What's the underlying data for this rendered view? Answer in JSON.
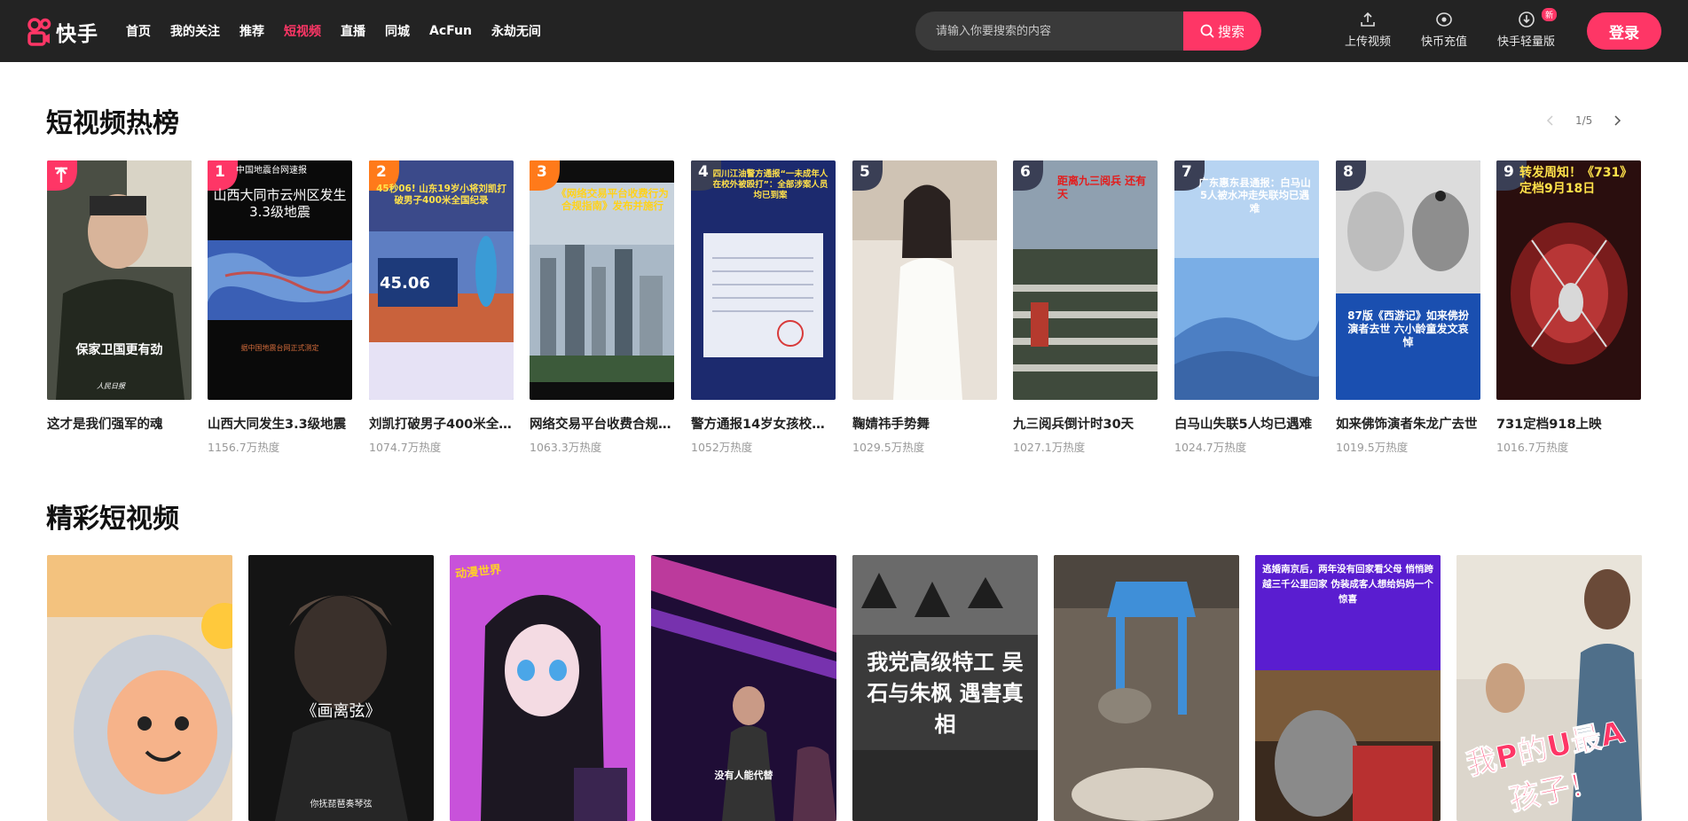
{
  "header": {
    "logo_text": "快手",
    "nav": [
      {
        "label": "首页",
        "active": false
      },
      {
        "label": "我的关注",
        "active": false
      },
      {
        "label": "推荐",
        "active": false
      },
      {
        "label": "短视频",
        "active": true
      },
      {
        "label": "直播",
        "active": false
      },
      {
        "label": "同城",
        "active": false
      },
      {
        "label": "AcFun",
        "active": false
      },
      {
        "label": "永劫无间",
        "active": false
      }
    ],
    "search": {
      "placeholder": "请输入你要搜索的内容",
      "button_label": "搜索"
    },
    "tools": [
      {
        "label": "上传视频",
        "icon": "upload-icon"
      },
      {
        "label": "快币充值",
        "icon": "coin-icon"
      },
      {
        "label": "快手轻量版",
        "icon": "download-icon",
        "badge": "新"
      }
    ],
    "login_label": "登录",
    "accent_color": "#fe3666"
  },
  "hot": {
    "title": "短视频热榜",
    "pager": "1/5",
    "items": [
      {
        "rank": "",
        "pinned": true,
        "title": "这才是我们强军的魂",
        "heat": "",
        "overlay": "保家卫国更有劲",
        "corner": "人民日报"
      },
      {
        "rank": "1",
        "title": "山西大同发生3.3级地震",
        "heat": "1156.7万热度",
        "overlay_top": "中国地震台网速报",
        "overlay": "山西大同市云州区发生3.3级地震",
        "overlay_bottom": "据中国地震台网正式测定"
      },
      {
        "rank": "2",
        "title": "刘凯打破男子400米全国纪录",
        "heat": "1074.7万热度",
        "overlay": "45秒06! 山东19岁小将刘凯打破男子400米全国纪录",
        "overlay_mid": "45.06"
      },
      {
        "rank": "3",
        "title": "网络交易平台收费合规指南发布",
        "heat": "1063.3万热度",
        "overlay": "《网络交易平台收费行为合规指南》发布并施行"
      },
      {
        "rank": "4",
        "title": "警方通报14岁女孩校外被殴打",
        "heat": "1052万热度",
        "overlay": "四川江油警方通报“一未成年人在校外被殴打”：全部涉案人员均已到案"
      },
      {
        "rank": "5",
        "title": "鞠婧祎手势舞",
        "heat": "1029.5万热度",
        "overlay": ""
      },
      {
        "rank": "6",
        "title": "九三阅兵倒计时30天",
        "heat": "1027.1万热度",
        "overlay": "距离九三阅兵 还有 天"
      },
      {
        "rank": "7",
        "title": "白马山失联5人均已遇难",
        "heat": "1024.7万热度",
        "overlay": "广东惠东县通报：白马山5人被水冲走失联均已遇难"
      },
      {
        "rank": "8",
        "title": "如来佛饰演者朱龙广去世",
        "heat": "1019.5万热度",
        "overlay": "87版《西游记》如来佛扮演者去世 六小龄童发文哀悼"
      },
      {
        "rank": "9",
        "title": "731定档918上映",
        "heat": "1016.7万热度",
        "overlay": "转发周知！《731》定档9月18日"
      }
    ]
  },
  "featured": {
    "title": "精彩短视频",
    "items": [
      {
        "overlay": ""
      },
      {
        "overlay": "《画离弦》",
        "caption": "你抚琵琶奏琴弦"
      },
      {
        "overlay": "",
        "badge": "动漫世界"
      },
      {
        "overlay": "",
        "caption": "没有人能代替"
      },
      {
        "overlay": "我党高级特工 吴石与朱枫 遇害真相"
      },
      {
        "overlay": ""
      },
      {
        "overlay": "逃婚南京后，两年没有回家看父母 悄悄跨越三千公里回家 伪装成客人想给妈妈一个惊喜"
      },
      {
        "overlay": "我P的U最A 孩子！"
      }
    ]
  }
}
